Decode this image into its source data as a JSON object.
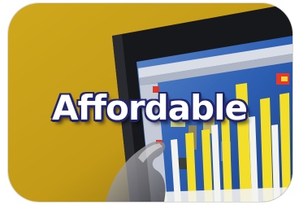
{
  "caption": "Affordable",
  "scene": {
    "description_icon": "monitor-with-bar-chart-photo",
    "colors": {
      "wall": "#c9a21a",
      "wall_dark": "#6e5a0c",
      "monitor_frame": "#17181c",
      "screen_bg": "#2b63b9",
      "bar_yellow": "#f3df2a",
      "bar_white": "#f2f2ee",
      "caption_outline": "#23246e"
    }
  }
}
